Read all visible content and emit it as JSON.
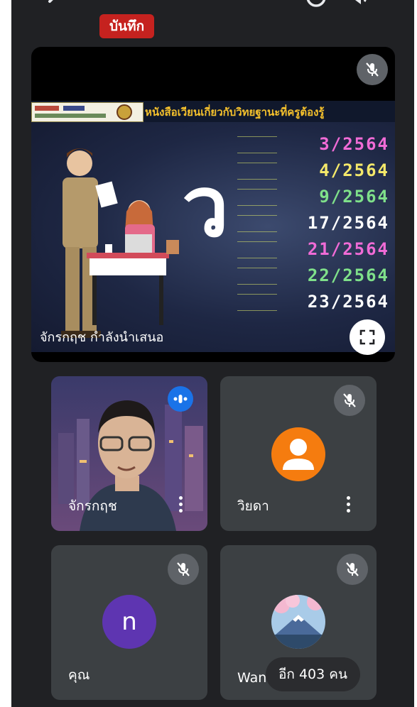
{
  "call": {
    "recording_badge": "บันทึก"
  },
  "presentation": {
    "caption": "จักรกฤช กำลังนำเสนอ",
    "slide": {
      "title": "หนังสือเวียนเกี่ยวกับวิทยฐานะที่ครูต้องรู้",
      "big_letter": "ว",
      "documents": [
        {
          "number": "3/2564",
          "color": "#f06bd6"
        },
        {
          "number": "4/2564",
          "color": "#f4e86a"
        },
        {
          "number": "9/2564",
          "color": "#7fe08a"
        },
        {
          "number": "17/2564",
          "color": "#ffffff"
        },
        {
          "number": "21/2564",
          "color": "#f06bd6"
        },
        {
          "number": "22/2564",
          "color": "#7fe08a"
        },
        {
          "number": "23/2564",
          "color": "#ffffff"
        }
      ]
    }
  },
  "participants": [
    {
      "name": "จักรกฤช",
      "status": "speaking",
      "type": "video"
    },
    {
      "name": "วิยดา",
      "status": "muted",
      "type": "avatar-default",
      "avatar_color": "#f57c0f"
    },
    {
      "name": "คุณ",
      "status": "muted",
      "type": "avatar-initial",
      "initial": "n",
      "avatar_color": "#5e35b1"
    },
    {
      "name": "Wanida",
      "status": "muted",
      "type": "avatar-photo"
    }
  ],
  "more_participants": "อีก 403 คน",
  "colors": {
    "background": "#202124",
    "tile": "#3c4043",
    "recording": "#c5221f",
    "speaking_indicator": "#1a73e8"
  }
}
